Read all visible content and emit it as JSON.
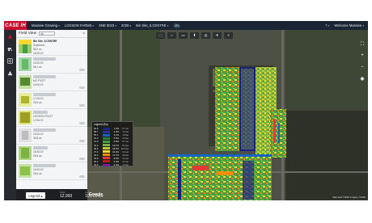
{
  "topbar": {
    "brand": "CASE IH",
    "breadcrumbs": [
      "Massive Growing",
      "LOGSON FARMS",
      "SNE 6023",
      "2020",
      "Bin Site_5,CENTRE"
    ],
    "badge": "2FL",
    "help": "?",
    "user": "Welcome Massive"
  },
  "panel": {
    "title": "Field View",
    "select_value": "All",
    "close": "×",
    "cards": [
      {
        "name": "Bin Site_5,CENTRE",
        "sub": "Soybeans",
        "meta": "58.2 ac",
        "date": "16.09.19",
        "right": "90.2 ac"
      },
      {
        "name": "Harvest",
        "sub": "",
        "meta": "",
        "date": "16.06.19",
        "right": "96.1 ac"
      },
      {
        "name": "Seeding",
        "sub": "MX PIVOT",
        "meta": "",
        "date": "16.06.19",
        "right": "31.6 ac"
      },
      {
        "name": "Application",
        "sub": "",
        "meta": "",
        "date": "17.06.19",
        "right": "26.6 ac"
      },
      {
        "name": "Application",
        "sub": "LOGSON PIVOT",
        "meta": "",
        "date": "17.06.19",
        "right": "26.6 ac"
      },
      {
        "name": "Application",
        "sub": "",
        "meta": "",
        "date": "16.06.19",
        "right": "35.8 ac"
      },
      {
        "name": "Tillage",
        "sub": "",
        "meta": "",
        "date": "16.06.19",
        "right": "26.6 ac"
      },
      {
        "name": "Tillage",
        "sub": "",
        "meta": "",
        "date": "16.06.19",
        "right": "26.6 ac"
      }
    ],
    "legend_button": "Legend"
  },
  "map": {
    "toolbar": [
      "⬚",
      "⌂",
      "▭",
      "⬆",
      "◎",
      "✛",
      "⌕"
    ],
    "controls": [
      "⛶",
      "+",
      "−",
      "◉"
    ],
    "google": "Google",
    "attribution": "Map data ©2020 Imagery ©2020"
  },
  "legend": {
    "title": "Legend (Bu)",
    "rows": [
      {
        "range": "62.5",
        "color": "#1a237e",
        "pct": "1.2%",
        "ac": "0.7 ac"
      },
      {
        "range": "58.7",
        "color": "#283593",
        "pct": "2.4%",
        "ac": "1.4 ac"
      },
      {
        "range": "55.1",
        "color": "#1565c0",
        "pct": "3.1%",
        "ac": "1.8 ac"
      },
      {
        "range": "51.3",
        "color": "#2e7d32",
        "pct": "5.6%",
        "ac": "3.3 ac"
      },
      {
        "range": "47.9",
        "color": "#43a047",
        "pct": "9.8%",
        "ac": "5.7 ac"
      },
      {
        "range": "44.2",
        "color": "#7cb342",
        "pct": "14.1%",
        "ac": "8.2 ac"
      },
      {
        "range": "40.6",
        "color": "#c0ca33",
        "pct": "18.3%",
        "ac": "10.6 ac"
      },
      {
        "range": "37.0",
        "color": "#fdd835",
        "pct": "16.2%",
        "ac": "9.4 ac"
      },
      {
        "range": "33.4",
        "color": "#fb8c00",
        "pct": "11.7%",
        "ac": "6.8 ac"
      },
      {
        "range": "29.8",
        "color": "#e53935",
        "pct": "8.9%",
        "ac": "5.2 ac"
      },
      {
        "range": "26.1",
        "color": "#b71c1c",
        "pct": "5.4%",
        "ac": "3.1 ac"
      },
      {
        "range": "22.5",
        "color": "#7b1fa2",
        "pct": "3.3%",
        "ac": "1.9 ac"
      }
    ]
  },
  "stats": [
    {
      "label": "Total",
      "value": "12,993"
    },
    {
      "label": "Avg",
      "value": "109.05 bu"
    }
  ],
  "colors": {
    "brand": "#c8102e",
    "topbar": "#1a2433"
  }
}
